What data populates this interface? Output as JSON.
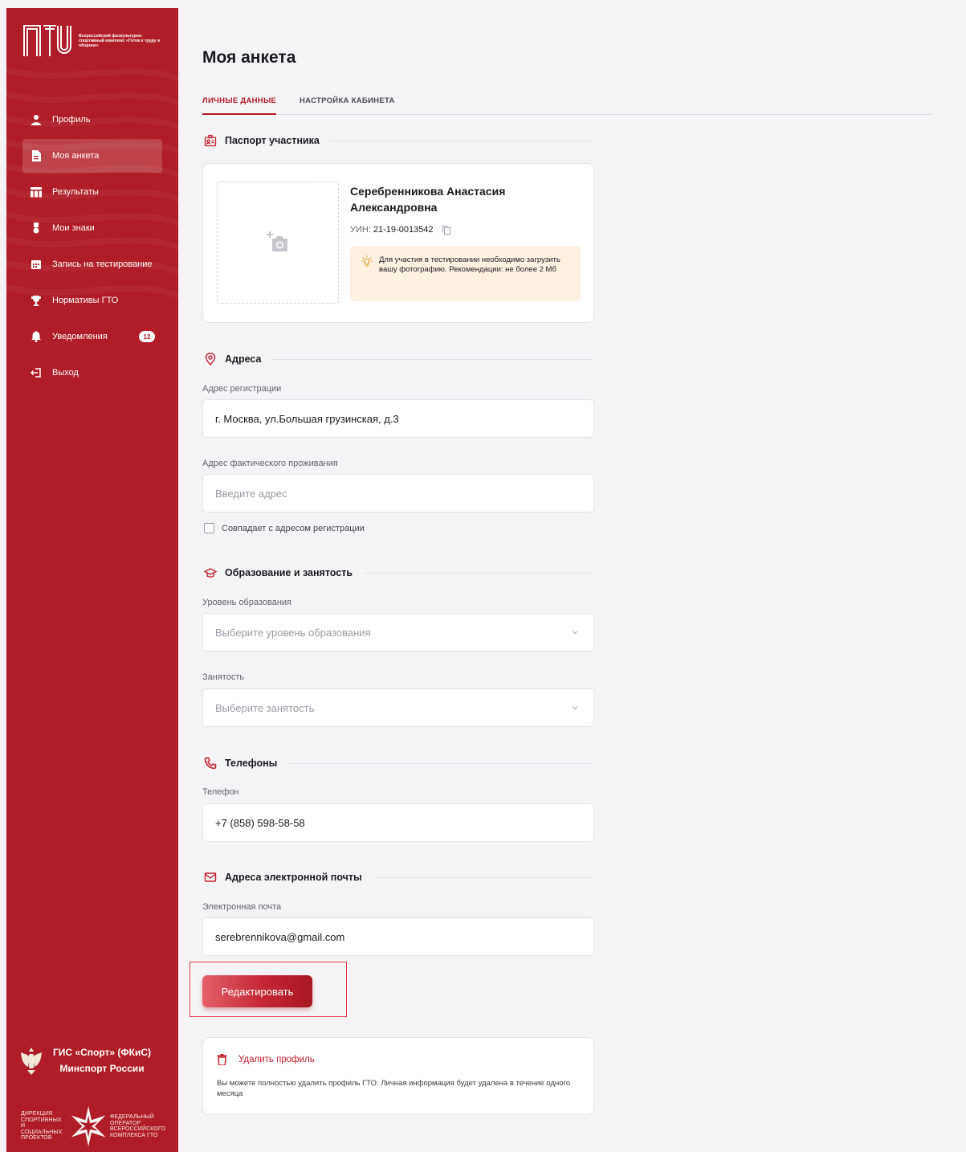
{
  "colors": {
    "brand": "#b01c27",
    "accent": "#c2202d",
    "notice_bg": "#fff1e2"
  },
  "logo": {
    "mark": "ГТО",
    "caption": "Всероссийский физкультурно-спортивный комплекс «Готов к труду и обороне»"
  },
  "sidebar": {
    "items": [
      {
        "label": "Профиль",
        "icon": "user-icon"
      },
      {
        "label": "Моя анкета",
        "icon": "document-icon",
        "active": true
      },
      {
        "label": "Результаты",
        "icon": "table-icon"
      },
      {
        "label": "Мои знаки",
        "icon": "medal-icon"
      },
      {
        "label": "Запись на тестирование",
        "icon": "calendar-icon"
      },
      {
        "label": "Нормативы ГТО",
        "icon": "trophy-icon"
      },
      {
        "label": "Уведомления",
        "icon": "bell-icon",
        "badge": "12"
      },
      {
        "label": "Выход",
        "icon": "logout-icon"
      }
    ],
    "gis": {
      "line1": "ГИС «Спорт» (ФКиС)",
      "line2": "Минспорт России"
    },
    "partner_left": [
      "ДИРЕКЦИЯ",
      "СПОРТИВНЫХ",
      "И СОЦИАЛЬНЫХ",
      "ПРОЕКТОВ"
    ],
    "partner_right": [
      "ФЕДЕРАЛЬНЫЙ",
      "ОПЕРАТОР",
      "ВСЕРОССИЙСКОГО",
      "КОМПЛЕКСА ГТО"
    ]
  },
  "page": {
    "title": "Моя анкета",
    "tabs": [
      {
        "label": "ЛИЧНЫЕ ДАННЫЕ",
        "active": true
      },
      {
        "label": "НАСТРОЙКА КАБИНЕТА",
        "active": false
      }
    ]
  },
  "passport": {
    "heading": "Паспорт участника",
    "name": "Серебренникова Анастасия Александровна",
    "uin_label": "УИН:",
    "uin_value": "21-19-0013542",
    "notice": "Для участия в тестировании необходимо загрузить вашу фотографию. Рекомендации: не более 2 Мб"
  },
  "addresses": {
    "heading": "Адреса",
    "registration_label": "Адрес регистрации",
    "registration_value": "г. Москва, ул.Большая грузинская, д.3",
    "actual_label": "Адрес фактического проживания",
    "actual_placeholder": "Введите адрес",
    "same_checkbox": "Совпадает с адресом регистрации"
  },
  "education": {
    "heading": "Образование и занятость",
    "level_label": "Уровень образования",
    "level_placeholder": "Выберите уровень образования",
    "employment_label": "Занятость",
    "employment_placeholder": "Выберите занятость"
  },
  "phones": {
    "heading": "Телефоны",
    "phone_label": "Телефон",
    "phone_value": "+7 (858) 598-58-58"
  },
  "emails": {
    "heading": "Адреса электронной почты",
    "email_label": "Электронная почта",
    "email_value": "serebrennikova@gmail.com"
  },
  "actions": {
    "edit_label": "Редактировать",
    "delete_label": "Удалить профиль",
    "delete_description": "Вы можете полностью удалить профиль ГТО. Личная информация будет удалена в течение одного месяца"
  }
}
